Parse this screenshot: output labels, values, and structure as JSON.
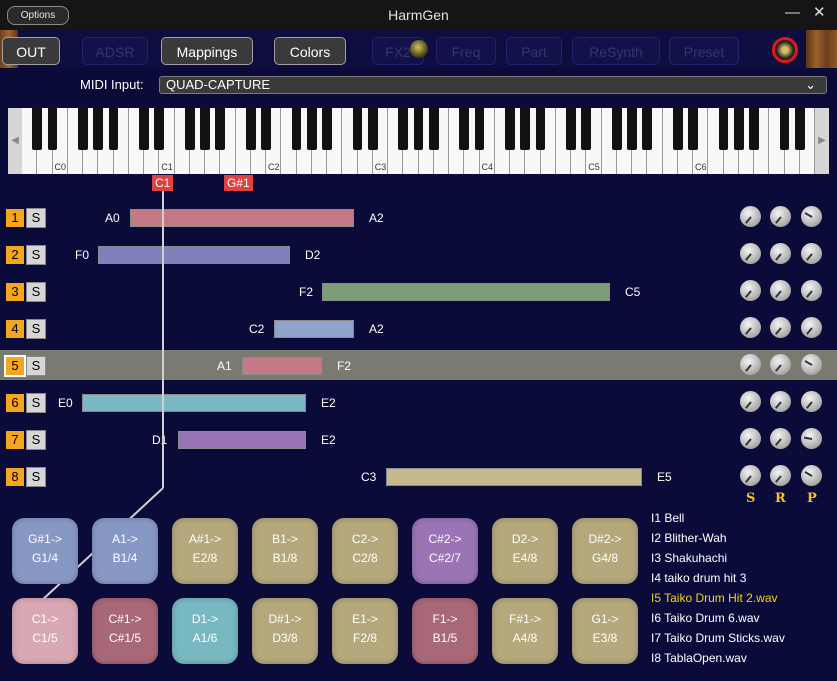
{
  "window": {
    "title": "HarmGen",
    "options_label": "Options",
    "minimize": "—",
    "close": "✕"
  },
  "tabs": [
    {
      "label": "OUT",
      "active": true
    },
    {
      "label": "ADSR",
      "active": false
    },
    {
      "label": "Mappings",
      "active": true
    },
    {
      "label": "Colors",
      "active": true
    },
    {
      "label": "FX2",
      "active": false
    },
    {
      "label": "Freq",
      "active": false
    },
    {
      "label": "Part",
      "active": false
    },
    {
      "label": "ReSynth",
      "active": false
    },
    {
      "label": "Preset",
      "active": false
    }
  ],
  "midi": {
    "label": "MIDI Input:",
    "value": "QUAD-CAPTURE"
  },
  "keyboard": {
    "octave_labels": [
      "C0",
      "C1",
      "C2",
      "C3",
      "C4",
      "C5",
      "C6"
    ]
  },
  "pressed_notes": [
    "C1",
    "G#1"
  ],
  "rows": [
    {
      "num": "1",
      "solo": "S",
      "low": "A0",
      "high": "A2",
      "color": "#c47a84"
    },
    {
      "num": "2",
      "solo": "S",
      "low": "F0",
      "high": "D2",
      "color": "#8080bc"
    },
    {
      "num": "3",
      "solo": "S",
      "low": "F2",
      "high": "C5",
      "color": "#7c9c78"
    },
    {
      "num": "4",
      "solo": "S",
      "low": "C2",
      "high": "A2",
      "color": "#8ea4c8"
    },
    {
      "num": "5",
      "solo": "S",
      "low": "A1",
      "high": "F2",
      "color": "#c47a84"
    },
    {
      "num": "6",
      "solo": "S",
      "low": "E0",
      "high": "E2",
      "color": "#7cb8c4"
    },
    {
      "num": "7",
      "solo": "S",
      "low": "D1",
      "high": "E2",
      "color": "#9a74b4"
    },
    {
      "num": "8",
      "solo": "S",
      "low": "C3",
      "high": "E5",
      "color": "#c4b88c"
    }
  ],
  "knob_labels": {
    "s": "S",
    "r": "R",
    "p": "P"
  },
  "pads_top": [
    {
      "l1": "G#1->",
      "l2": "G1/4",
      "color": "#8898c4"
    },
    {
      "l1": "A1->",
      "l2": "B1/4",
      "color": "#8898c4"
    },
    {
      "l1": "A#1->",
      "l2": "E2/8",
      "color": "#b4a87c"
    },
    {
      "l1": "B1->",
      "l2": "B1/8",
      "color": "#b4a87c"
    },
    {
      "l1": "C2->",
      "l2": "C2/8",
      "color": "#b4a87c"
    },
    {
      "l1": "C#2->",
      "l2": "C#2/7",
      "color": "#9a74b4"
    },
    {
      "l1": "D2->",
      "l2": "E4/8",
      "color": "#b4a87c"
    },
    {
      "l1": "D#2->",
      "l2": "G4/8",
      "color": "#b4a87c"
    }
  ],
  "pads_bottom": [
    {
      "l1": "C1->",
      "l2": "C1/5",
      "color": "#d8a8b4"
    },
    {
      "l1": "C#1->",
      "l2": "C#1/5",
      "color": "#a86878"
    },
    {
      "l1": "D1->",
      "l2": "A1/6",
      "color": "#78b8c0"
    },
    {
      "l1": "D#1->",
      "l2": "D3/8",
      "color": "#b4a87c"
    },
    {
      "l1": "E1->",
      "l2": "F2/8",
      "color": "#b4a87c"
    },
    {
      "l1": "F1->",
      "l2": "B1/5",
      "color": "#a86878"
    },
    {
      "l1": "F#1->",
      "l2": "A4/8",
      "color": "#b4a87c"
    },
    {
      "l1": "G1->",
      "l2": "E3/8",
      "color": "#b4a87c"
    }
  ],
  "instruments": [
    "I1 Bell",
    "I2 Blither-Wah",
    "I3 Shakuhachi",
    "I4 taiko drum hit 3",
    "I5 Taiko Drum Hit 2.wav",
    "I6 Taiko Drum 6.wav",
    "I7 Taiko Drum Sticks.wav",
    "I8 TablaOpen.wav"
  ]
}
